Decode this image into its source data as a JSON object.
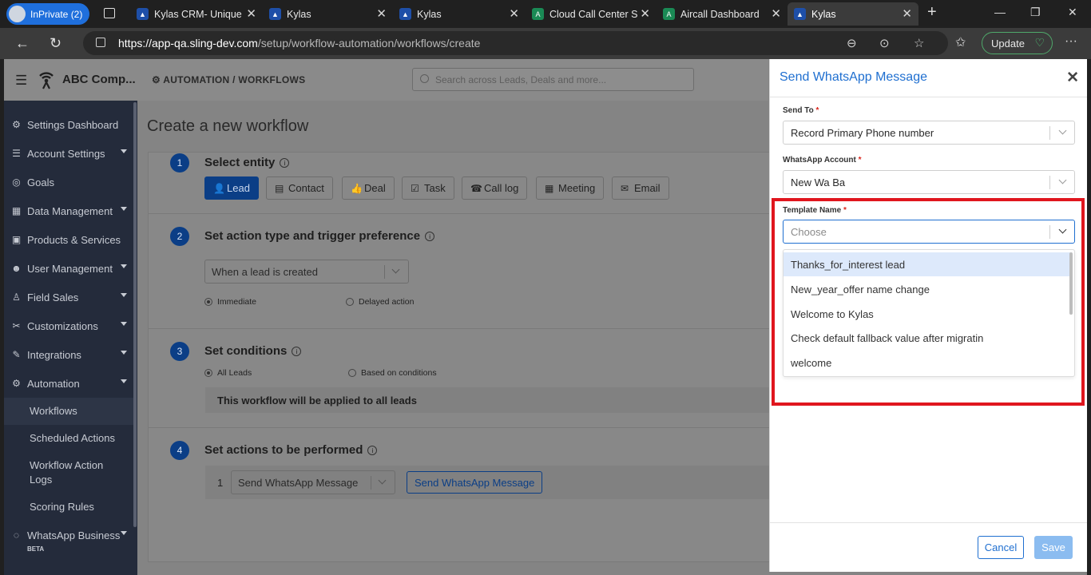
{
  "browser": {
    "inprivate_label": "InPrivate (2)",
    "tabs": [
      {
        "title": "Kylas CRM- Unique",
        "favicon": "kylas-icon",
        "active": false
      },
      {
        "title": "Kylas",
        "favicon": "kylas-icon",
        "active": false
      },
      {
        "title": "Kylas",
        "favicon": "kylas-icon",
        "active": false
      },
      {
        "title": "Cloud Call Center S",
        "favicon": "cloud-call-icon",
        "active": false
      },
      {
        "title": "Aircall Dashboard",
        "favicon": "cloud-call-icon",
        "active": false
      },
      {
        "title": "Kylas",
        "favicon": "kylas-icon",
        "active": true
      }
    ],
    "url_host": "https://app-qa.sling-dev.com",
    "url_path": "/setup/workflow-automation/workflows/create",
    "update_label": "Update"
  },
  "app": {
    "company_name": "ABC Comp...",
    "breadcrumb": "AUTOMATION / WORKFLOWS",
    "search_placeholder": "Search across Leads, Deals and more...",
    "page_title": "Create a new workflow"
  },
  "sidebar": {
    "items": [
      {
        "label": "Settings Dashboard",
        "icon": "gauge-icon",
        "caret": false
      },
      {
        "label": "Account Settings",
        "icon": "sliders-icon",
        "caret": true
      },
      {
        "label": "Goals",
        "icon": "target-icon",
        "caret": false
      },
      {
        "label": "Data Management",
        "icon": "table-icon",
        "caret": true
      },
      {
        "label": "Products & Services",
        "icon": "box-icon",
        "caret": false
      },
      {
        "label": "User Management",
        "icon": "users-icon",
        "caret": true
      },
      {
        "label": "Field Sales",
        "icon": "walk-icon",
        "caret": true
      },
      {
        "label": "Customizations",
        "icon": "tools-icon",
        "caret": true
      },
      {
        "label": "Integrations",
        "icon": "magic-icon",
        "caret": true
      },
      {
        "label": "Automation",
        "icon": "cogs-icon",
        "caret": true
      }
    ],
    "subitems": [
      "Workflows",
      "Scheduled Actions",
      "Workflow Action Logs",
      "Scoring Rules"
    ],
    "whatsapp_label": "WhatsApp Business",
    "beta_label": "BETA"
  },
  "steps": [
    {
      "num": "1",
      "title": "Select entity"
    },
    {
      "num": "2",
      "title": "Set action type and trigger preference"
    },
    {
      "num": "3",
      "title": "Set conditions"
    },
    {
      "num": "4",
      "title": "Set actions to be performed"
    }
  ],
  "entities": [
    {
      "label": "Lead",
      "icon": "user-icon",
      "active": true
    },
    {
      "label": "Contact",
      "icon": "address-card-icon",
      "active": false
    },
    {
      "label": "Deal",
      "icon": "thumbs-up-icon",
      "active": false
    },
    {
      "label": "Task",
      "icon": "check-square-icon",
      "active": false
    },
    {
      "label": "Call log",
      "icon": "phone-icon",
      "active": false
    },
    {
      "label": "Meeting",
      "icon": "calendar-icon",
      "active": false
    },
    {
      "label": "Email",
      "icon": "envelope-icon",
      "active": false
    }
  ],
  "trigger": {
    "selected": "When a lead is created",
    "radio_immediate": "Immediate",
    "radio_delayed": "Delayed action"
  },
  "conditions": {
    "radio_all": "All Leads",
    "radio_based": "Based on conditions",
    "applied_text": "This workflow will be applied to all leads"
  },
  "actions": {
    "index": "1",
    "selected": "Send WhatsApp Message",
    "button_label": "Send WhatsApp Message"
  },
  "drawer": {
    "title": "Send WhatsApp Message",
    "send_to_label": "Send To",
    "send_to_value": "Record Primary Phone number",
    "account_label": "WhatsApp Account",
    "account_value": "New Wa Ba",
    "template_label": "Template Name",
    "required_mark": "*",
    "template_placeholder": "Choose",
    "options": [
      "Thanks_for_interest lead",
      "New_year_offer name change",
      "Welcome to Kylas",
      "Check default fallback value after migratin",
      "welcome"
    ],
    "cancel_label": "Cancel",
    "save_label": "Save"
  },
  "colors": {
    "accent": "#1f6fd0",
    "highlight_box": "#e0161e",
    "sidebar_bg": "#242b3b"
  }
}
